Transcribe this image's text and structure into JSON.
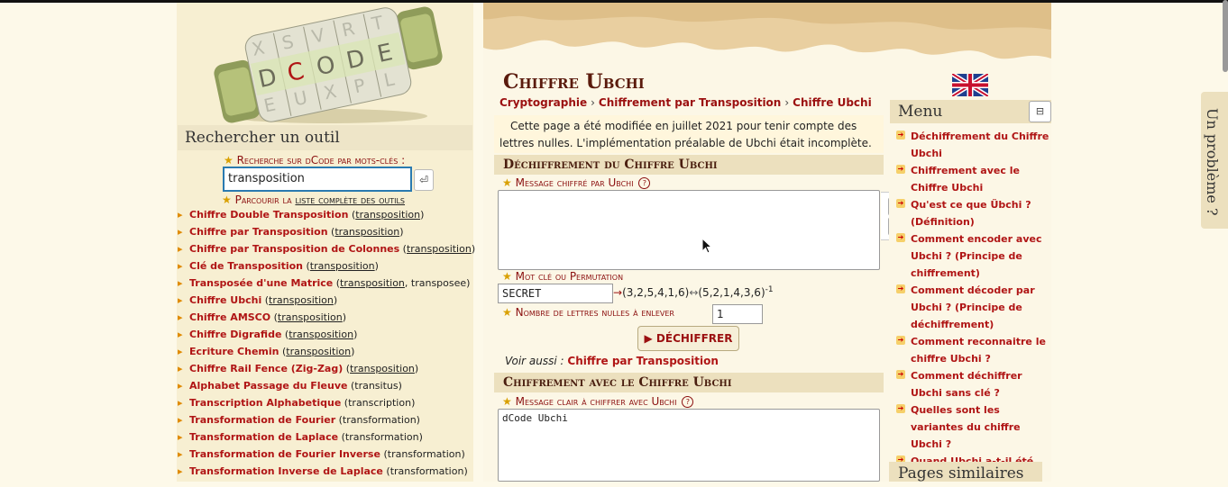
{
  "logo": {
    "letters": [
      "D",
      "C",
      "O",
      "D",
      "E"
    ]
  },
  "search": {
    "heading": "Rechercher un outil",
    "keyword_label": "Recherche sur dCode par mots-clés :",
    "value": "transposition",
    "submit_icon": "⏎",
    "browse_prefix": "Parcourir la",
    "browse_link": "liste complète des outils"
  },
  "tools": [
    {
      "name": "Chiffre Double Transposition",
      "kw": "transposition",
      "extra": ""
    },
    {
      "name": "Chiffre par Transposition",
      "kw": "transposition",
      "extra": ""
    },
    {
      "name": "Chiffre par Transposition de Colonnes",
      "kw": "transposition",
      "extra": ""
    },
    {
      "name": "Clé de Transposition",
      "kw": "transposition",
      "extra": ""
    },
    {
      "name": "Transposée d'une Matrice",
      "kw": "transposition",
      "extra": ", transposee"
    },
    {
      "name": "Chiffre Ubchi",
      "kw": "transposition",
      "extra": ""
    },
    {
      "name": "Chiffre AMSCO",
      "kw": "transposition",
      "extra": ""
    },
    {
      "name": "Chiffre Digrafide",
      "kw": "transposition",
      "extra": ""
    },
    {
      "name": "Ecriture Chemin",
      "kw": "transposition",
      "extra": ""
    },
    {
      "name": "Chiffre Rail Fence (Zig-Zag)",
      "kw": "transposition",
      "extra": ""
    },
    {
      "name": "Alphabet Passage du Fleuve",
      "kw": "transitus",
      "extra": ""
    },
    {
      "name": "Transcription Alphabetique",
      "kw": "transcription",
      "extra": ""
    },
    {
      "name": "Transformation de Fourier",
      "kw": "transformation",
      "extra": ""
    },
    {
      "name": "Transformation de Laplace",
      "kw": "transformation",
      "extra": ""
    },
    {
      "name": "Transformation de Fourier Inverse",
      "kw": "transformation",
      "extra": ""
    },
    {
      "name": "Transformation Inverse de Laplace",
      "kw": "transformation",
      "extra": ""
    }
  ],
  "page": {
    "title": "Chiffre Ubchi",
    "breadcrumb": [
      "Cryptographie",
      "Chiffrement par Transposition",
      "Chiffre Ubchi"
    ],
    "breadcrumb_sep": "›",
    "notice": "Cette page a été modifiée en juillet 2021 pour tenir compte des lettres nulles. L'implémentation préalable de Ubchi était incomplète."
  },
  "decipher": {
    "heading": "Déchiffrement du Chiffre Ubchi",
    "message_label": "Message chiffré par Ubchi",
    "message_value": "",
    "help": "?",
    "trash_icon": "🗑",
    "swap_icon": "⇄",
    "keyword_label": "Mot clé ou Permutation",
    "keyword_value": "SECRET",
    "perm_arrow": "→",
    "perm": "(3,2,5,4,1,6)",
    "perm_swap": "↔",
    "perm_inverse": "(5,2,1,4,3,6)",
    "perm_exp": "-1",
    "nulls_label": "Nombre de lettres nulles à enlever",
    "nulls_value": "1",
    "button": "▶ DÉCHIFFRER",
    "see_also_label": "Voir aussi :",
    "see_also_link": "Chiffre par Transposition"
  },
  "encipher": {
    "heading": "Chiffrement avec le Chiffre Ubchi",
    "message_label": "Message clair à chiffrer avec Ubchi",
    "message_value": "dCode Ubchi",
    "help": "?"
  },
  "menu": {
    "heading": "Menu",
    "collapse_icon": "⊟",
    "items": [
      "Déchiffrement du Chiffre Ubchi",
      "Chiffrement avec le Chiffre Ubchi",
      "Qu'est ce que Übchi ? (Définition)",
      "Comment encoder avec Ubchi ? (Principe de chiffrement)",
      "Comment décoder par Ubchi ? (Principe de déchiffrement)",
      "Comment reconnaitre le chiffre Ubchi ?",
      "Comment déchiffrer Ubchi sans clé ?",
      "Quelles sont les variantes du chiffre Ubchi ?",
      "Quand Ubchi a-t-il été inventé ?"
    ],
    "similar_heading": "Pages similaires"
  },
  "feedback_tab": "Un problème ?",
  "colors": {
    "accent": "#b01515",
    "heading": "#5a1a0c",
    "parchment": "#ece0be",
    "background": "#fdf9e9"
  }
}
